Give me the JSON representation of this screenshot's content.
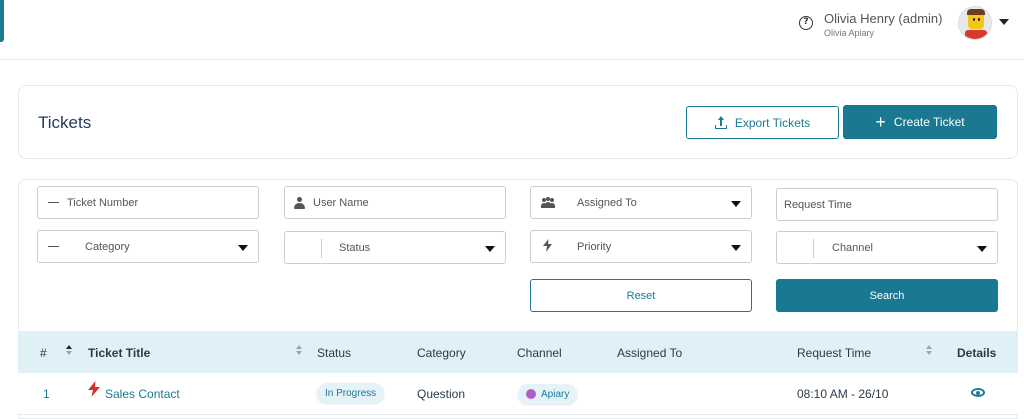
{
  "header": {
    "user_name": "Olivia Henry (admin)",
    "user_org": "Olivia Apiary",
    "help_icon": "question-circle-icon",
    "avatar_icon": "lego-avatar"
  },
  "page": {
    "title": "Tickets",
    "export_label": "Export Tickets",
    "create_label": "Create Ticket"
  },
  "filters": {
    "ticket_number": "Ticket Number",
    "user_name": "User Name",
    "assigned_to": "Assigned To",
    "request_time": "Request Time",
    "category": "Category",
    "status": "Status",
    "priority": "Priority",
    "channel": "Channel",
    "reset_label": "Reset",
    "search_label": "Search"
  },
  "table": {
    "columns": [
      "#",
      "Ticket Title",
      "Status",
      "Category",
      "Channel",
      "Assigned To",
      "Request Time",
      "Details"
    ],
    "rows": [
      {
        "num": "1",
        "title": "Sales Contact",
        "status": "In Progress",
        "category": "Question",
        "channel": "Apiary",
        "assigned_to": "",
        "request_time": "08:10 AM - 26/10"
      }
    ]
  },
  "colors": {
    "primary": "#1a7890",
    "header_bg": "#dff0f7",
    "priority_high": "#d9302a",
    "channel_dot": "#b25cc6"
  }
}
